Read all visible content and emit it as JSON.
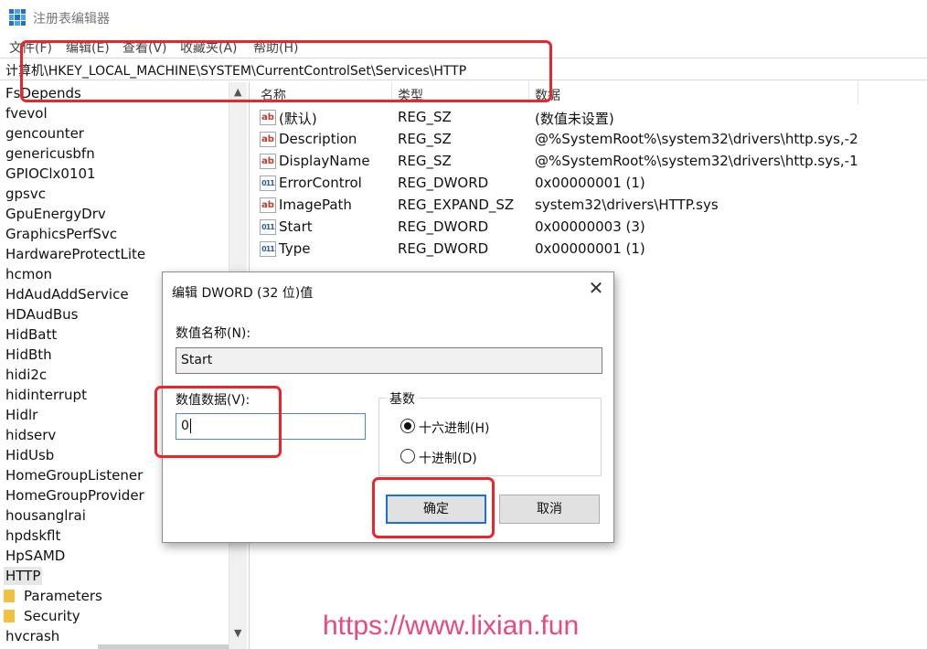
{
  "window": {
    "title": "注册表编辑器",
    "icon": "registry-icon"
  },
  "menu": [
    "文件(F)",
    "编辑(E)",
    "查看(V)",
    "收藏夹(A)",
    "帮助(H)"
  ],
  "address": "计算机\\HKEY_LOCAL_MACHINE\\SYSTEM\\CurrentControlSet\\Services\\HTTP",
  "tree": {
    "items": [
      "FsDepends",
      "fvevol",
      "gencounter",
      "genericusbfn",
      "GPIOClx0101",
      "gpsvc",
      "GpuEnergyDrv",
      "GraphicsPerfSvc",
      "HardwareProtectLite",
      "hcmon",
      "HdAudAddService",
      "HDAudBus",
      "HidBatt",
      "HidBth",
      "hidi2c",
      "hidinterrupt",
      "Hidlr",
      "hidserv",
      "HidUsb",
      "HomeGroupListener",
      "HomeGroupProvider",
      "housanglrai",
      "hpdskflt",
      "HpSAMD",
      "HTTP"
    ],
    "selected": "HTTP",
    "children": [
      "Parameters",
      "Security"
    ],
    "after": "hvcrash"
  },
  "list": {
    "columns": {
      "name": "名称",
      "type": "类型",
      "data": "数据"
    },
    "rows": [
      {
        "icon": "string-value-icon",
        "name": "(默认)",
        "type": "REG_SZ",
        "data": "(数值未设置)"
      },
      {
        "icon": "string-value-icon",
        "name": "Description",
        "type": "REG_SZ",
        "data": "@%SystemRoot%\\system32\\drivers\\http.sys,-2"
      },
      {
        "icon": "string-value-icon",
        "name": "DisplayName",
        "type": "REG_SZ",
        "data": "@%SystemRoot%\\system32\\drivers\\http.sys,-1"
      },
      {
        "icon": "binary-value-icon",
        "name": "ErrorControl",
        "type": "REG_DWORD",
        "data": "0x00000001 (1)"
      },
      {
        "icon": "string-value-icon",
        "name": "ImagePath",
        "type": "REG_EXPAND_SZ",
        "data": "system32\\drivers\\HTTP.sys"
      },
      {
        "icon": "binary-value-icon",
        "name": "Start",
        "type": "REG_DWORD",
        "data": "0x00000003 (3)"
      },
      {
        "icon": "binary-value-icon",
        "name": "Type",
        "type": "REG_DWORD",
        "data": "0x00000001 (1)"
      }
    ]
  },
  "dialog": {
    "title": "编辑 DWORD (32 位)值",
    "name_label": "数值名称(N):",
    "name_value": "Start",
    "data_label": "数值数据(V):",
    "data_value": "0",
    "base_label": "基数",
    "radio_hex": "十六进制(H)",
    "radio_dec": "十进制(D)",
    "selected_base": "hex",
    "ok": "确定",
    "cancel": "取消"
  },
  "annotation_color": "#e8262b",
  "watermark": "https://www.lixian.fun"
}
